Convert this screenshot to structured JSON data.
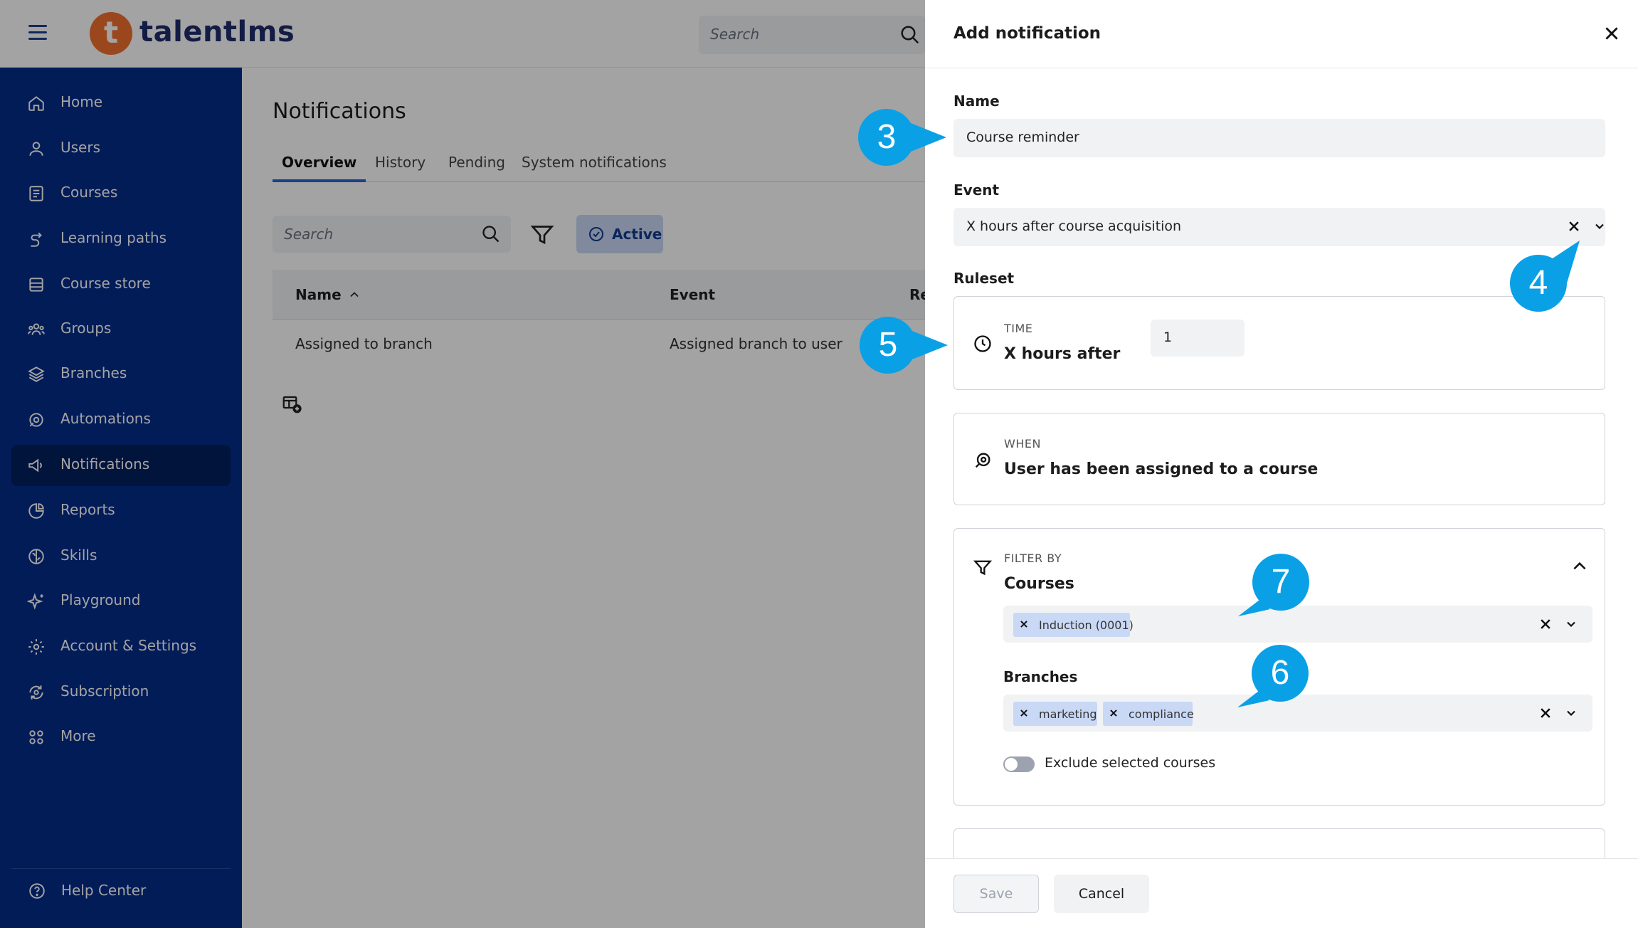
{
  "app": {
    "logo_letter": "t",
    "logo_text": "talentlms",
    "search_placeholder": "Search"
  },
  "sidebar": {
    "items": [
      {
        "label": "Home",
        "icon": "home-icon"
      },
      {
        "label": "Users",
        "icon": "user-icon"
      },
      {
        "label": "Courses",
        "icon": "book-icon"
      },
      {
        "label": "Learning paths",
        "icon": "path-icon"
      },
      {
        "label": "Course store",
        "icon": "store-icon"
      },
      {
        "label": "Groups",
        "icon": "groups-icon"
      },
      {
        "label": "Branches",
        "icon": "layers-icon"
      },
      {
        "label": "Automations",
        "icon": "automation-icon"
      },
      {
        "label": "Notifications",
        "icon": "megaphone-icon",
        "active": true
      },
      {
        "label": "Reports",
        "icon": "pie-chart-icon"
      },
      {
        "label": "Skills",
        "icon": "brain-icon"
      },
      {
        "label": "Playground",
        "icon": "sparkle-icon"
      },
      {
        "label": "Account & Settings",
        "icon": "gear-icon"
      },
      {
        "label": "Subscription",
        "icon": "refresh-gear-icon"
      },
      {
        "label": "More",
        "icon": "grid-icon"
      }
    ],
    "help_center": "Help Center"
  },
  "main": {
    "title": "Notifications",
    "tabs": [
      {
        "label": "Overview",
        "active": true
      },
      {
        "label": "History"
      },
      {
        "label": "Pending"
      },
      {
        "label": "System notifications"
      }
    ],
    "search_placeholder": "Search",
    "active_filter_label": "Active",
    "table": {
      "columns": [
        "Name",
        "Event",
        "Re"
      ],
      "rows": [
        {
          "name": "Assigned to branch",
          "event": "Assigned branch to user"
        }
      ]
    }
  },
  "drawer": {
    "title": "Add notification",
    "name_label": "Name",
    "name_value": "Course reminder",
    "event_label": "Event",
    "event_value": "X hours after course acquisition",
    "ruleset_label": "Ruleset",
    "time_card": {
      "overline": "TIME",
      "title": "X hours after",
      "value": "1"
    },
    "when_card": {
      "overline": "WHEN",
      "title": "User has been assigned to a course"
    },
    "filter_card": {
      "overline": "FILTER BY",
      "courses_label": "Courses",
      "courses_selected": [
        "Induction (0001)"
      ],
      "branches_label": "Branches",
      "branches_selected": [
        "marketing",
        "compliance"
      ],
      "exclude_label": "Exclude selected courses",
      "exclude_enabled": false
    },
    "save_label": "Save",
    "cancel_label": "Cancel"
  },
  "callouts": [
    "3",
    "4",
    "5",
    "7",
    "6"
  ],
  "colors": {
    "sidebar": "#042c8a",
    "sidebar_active": "#03205f",
    "accent": "#2b63d9",
    "callout": "#0aa0e6",
    "logo": "#f3702f",
    "chip": "#c9d8f5"
  }
}
